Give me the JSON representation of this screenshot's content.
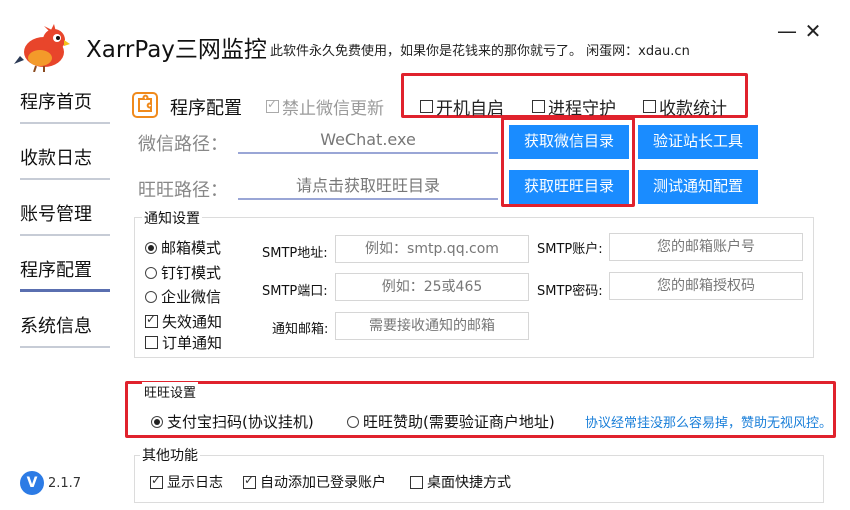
{
  "header": {
    "title": "XarrPay三网监控",
    "subtitle": "此软件永久免费使用，如果你是花钱来的那你就亏了。 闲蛋网：xdau.cn",
    "minimize_glyph": "—",
    "close_glyph": "✕"
  },
  "sidebar": {
    "items": [
      {
        "label": "程序首页"
      },
      {
        "label": "收款日志"
      },
      {
        "label": "账号管理"
      },
      {
        "label": "程序配置"
      },
      {
        "label": "系统信息"
      }
    ],
    "version": "2.1.7",
    "version_badge": "V"
  },
  "config": {
    "title": "程序配置",
    "disable_update": {
      "label": "禁止微信更新",
      "checked": true
    },
    "autostart": {
      "label": "开机自启",
      "checked": false
    },
    "process_guard": {
      "label": "进程守护",
      "checked": false
    },
    "payment_stats": {
      "label": "收款统计",
      "checked": false
    },
    "wechat_path_label": "微信路径：",
    "wechat_path_value": "WeChat.exe",
    "wangwang_path_label": "旺旺路径：",
    "wangwang_path_value": "请点击获取旺旺目录",
    "btn_get_wechat_dir": "获取微信目录",
    "btn_verify_tool": "验证站长工具",
    "btn_get_wangwang_dir": "获取旺旺目录",
    "btn_test_notify": "测试通知配置"
  },
  "notify": {
    "legend": "通知设置",
    "modes": [
      {
        "label": "邮箱模式",
        "checked": true
      },
      {
        "label": "钉钉模式",
        "checked": false
      },
      {
        "label": "企业微信",
        "checked": false
      }
    ],
    "fail_notify": {
      "label": "失效通知",
      "checked": true
    },
    "order_notify": {
      "label": "订单通知",
      "checked": false
    },
    "smtp_host_label": "SMTP地址:",
    "smtp_host_placeholder": "例如：smtp.qq.com",
    "smtp_port_label": "SMTP端口:",
    "smtp_port_placeholder": "例如：25或465",
    "notify_email_label": "通知邮箱:",
    "notify_email_placeholder": "需要接收通知的邮箱",
    "smtp_account_label": "SMTP账户:",
    "smtp_account_placeholder": "您的邮箱账户号",
    "smtp_password_label": "SMTP密码:",
    "smtp_password_placeholder": "您的邮箱授权码"
  },
  "wangwang": {
    "legend": "旺旺设置",
    "option_alipay": {
      "label": "支付宝扫码(协议挂机)",
      "checked": true
    },
    "option_sponsor": {
      "label": "旺旺赞助(需要验证商户地址)",
      "checked": false
    },
    "note": "协议经常挂没那么容易掉，赞助无视风控。"
  },
  "other": {
    "legend": "其他功能",
    "show_log": {
      "label": "显示日志",
      "checked": true
    },
    "auto_add": {
      "label": "自动添加已登录账户",
      "checked": true
    },
    "desktop_shortcut": {
      "label": "桌面快捷方式",
      "checked": false
    }
  },
  "colors": {
    "accent_blue": "#1a8cff",
    "highlight_red": "#e0222d",
    "nav_active": "#5a6fb0"
  }
}
